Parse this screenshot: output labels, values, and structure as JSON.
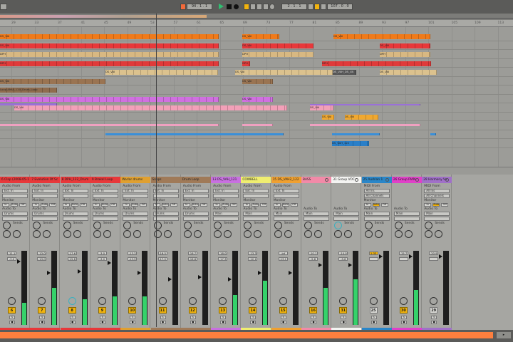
{
  "transport": {
    "position": "94 . 1 . 1",
    "loop_start": "2 . 1 . 1",
    "loop_length": "107 . 0 . 0",
    "record_color": "#f26a3b",
    "play_color": "#2fbf71",
    "accent": "#f1b30e"
  },
  "ruler": {
    "ticks": [
      "29",
      "33",
      "37",
      "41",
      "45",
      "49",
      "53",
      "57",
      "61",
      "65",
      "69",
      "73",
      "77",
      "81",
      "85",
      "89",
      "93",
      "97",
      "101",
      "105",
      "109",
      "113"
    ]
  },
  "arrangement": {
    "lanes": [
      {
        "label": "DS_VAI",
        "color": "#f07a1a"
      },
      {
        "label": "DS_VAI",
        "color": "#e8383a"
      },
      {
        "label": "DPH",
        "color": "#d8b882"
      },
      {
        "label": "DPH",
        "color": "#e03a3a"
      },
      {
        "label": "DS_VAI",
        "color": "#dcc28e"
      },
      {
        "label": "DS_VAI",
        "color": "#9a7452"
      },
      {
        "label": "Loop AMIA_120_Drum_Loop",
        "color": "#8f6c4e"
      },
      {
        "label": "DS_VAI",
        "color": "#d070e0"
      },
      {
        "label": "DS_VAI",
        "color": "#f2a0b8"
      },
      {
        "label": "DS_VAI",
        "color": "#f0a830"
      },
      {
        "label": "",
        "color": "#f0a0c0"
      },
      {
        "label": "",
        "color": "#3a8fd8"
      },
      {
        "label": "DS_VAH_122",
        "color": "#2a7fc8"
      }
    ],
    "selected_clip": "DS_VAH_DS_VA"
  },
  "mixer": {
    "labels": {
      "audio_from": "Audio From",
      "midi_from": "MIDI From",
      "monitor": "Monitor",
      "audio_to": "Audio To",
      "sends": "Sends",
      "in": "In",
      "auto": "Auto",
      "off": "Off",
      "s": "S",
      "solo": "●"
    },
    "strips": [
      {
        "name": "6 Clap (2008-05-1",
        "color": "#e8383a",
        "num": "6",
        "vol": "-11.1",
        "pk": "-3.0",
        "level": 0.3,
        "fader": 0.86,
        "type": "audio",
        "from": "Ext. In",
        "to": "Drums",
        "armed": true
      },
      {
        "name": "7 Evolution Of Sc",
        "color": "#e8383a",
        "num": "7",
        "vol": "-13.0",
        "pk": "-13.0",
        "level": 0.5,
        "fader": 0.7,
        "type": "audio",
        "from": "Ext. In",
        "to": "Drums",
        "armed": true
      },
      {
        "name": "8 DPH_122_Drum",
        "color": "#e8383a",
        "num": "8",
        "vol": "-17.6",
        "pk": "-15.8",
        "level": 0.35,
        "fader": 0.72,
        "type": "audio",
        "from": "Ext. In",
        "to": "Drums",
        "armed": true
      },
      {
        "name": "9 Brakel Loop",
        "color": "#e8383a",
        "num": "9",
        "vol": "-3.0",
        "pk": "-3.0",
        "level": 0.38,
        "fader": 0.84,
        "type": "audio",
        "from": "Ext. In",
        "to": "Drums",
        "armed": true
      },
      {
        "name": "Warlar drums",
        "color": "#e0a030",
        "num": "10",
        "vol": "-13.3",
        "pk": "-13.9",
        "level": 0.38,
        "fader": 0.7,
        "type": "audio",
        "from": "Ext. In",
        "to": "Drums",
        "armed": true
      },
      {
        "name": "Snaps",
        "color": "#a07a58",
        "num": "11",
        "vol": "-16.5",
        "pk": "-17.0",
        "level": 0,
        "fader": 0.62,
        "type": "audio",
        "from": "Ext. In",
        "to": "Drums",
        "armed": true
      },
      {
        "name": "Drum Loop",
        "color": "#a07a58",
        "num": "12",
        "vol": "-16.7",
        "pk": "-16.6",
        "level": 0,
        "fader": 0.64,
        "type": "audio",
        "from": "Ext. In",
        "to": "Drums",
        "armed": true
      },
      {
        "name": "13 DS_VAH_121",
        "color": "#c870e0",
        "num": "13",
        "vol": "-18.0",
        "pk": "-17.3",
        "level": 0.4,
        "fader": 0.62,
        "type": "audio",
        "from": "Ext. In",
        "to": "Main",
        "armed": true
      },
      {
        "name": "COWBELL",
        "color": "#f0ee70",
        "num": "14",
        "vol": "-13.3",
        "pk": "-12.1",
        "level": 0.6,
        "fader": 0.7,
        "type": "audio",
        "from": "Ext. In",
        "to": "Main",
        "armed": true
      },
      {
        "name": "15 DS_VAH2_122",
        "color": "#f0a030",
        "num": "15",
        "vol": "-inf",
        "pk": "-13.1",
        "level": 0,
        "fader": 0.7,
        "type": "audio",
        "from": "Ext. In",
        "to": "Main",
        "armed": true
      },
      {
        "name": "BASS",
        "color": "#f28aa8",
        "num": "16",
        "vol": "-10.1",
        "pk": "-5.8",
        "level": 0.5,
        "fader": 0.81,
        "type": "group",
        "to": "Main",
        "armed": true
      },
      {
        "name": "31 Group VOC",
        "color": "#f4f4f2",
        "num": "31",
        "vol": "-14.0",
        "pk": "-5.8",
        "level": 0.62,
        "fader": 0.81,
        "type": "group",
        "to": "Main",
        "armed": true
      },
      {
        "name": "25 Audrian 1",
        "color": "#2a86c8",
        "num": "25",
        "vol": "1.33",
        "pk": "",
        "level": 0,
        "fader": 0.92,
        "type": "midi",
        "from": "All Ins",
        "ch": "All Channels",
        "to": "Main",
        "armed": false
      },
      {
        "name": "26 Group PIAN",
        "color": "#e040c8",
        "num": "30",
        "vol": "-15.7",
        "pk": "",
        "level": 0.47,
        "fader": 0.92,
        "type": "group",
        "to": "Main",
        "armed": true
      },
      {
        "name": "29 Harmony Vo",
        "color": "#a070c8",
        "num": "29",
        "vol": "-20.9",
        "pk": "",
        "level": 0,
        "fader": 0.92,
        "type": "midi",
        "from": "All Ins",
        "ch": "All Channels",
        "to": "Main",
        "armed": false
      }
    ]
  }
}
